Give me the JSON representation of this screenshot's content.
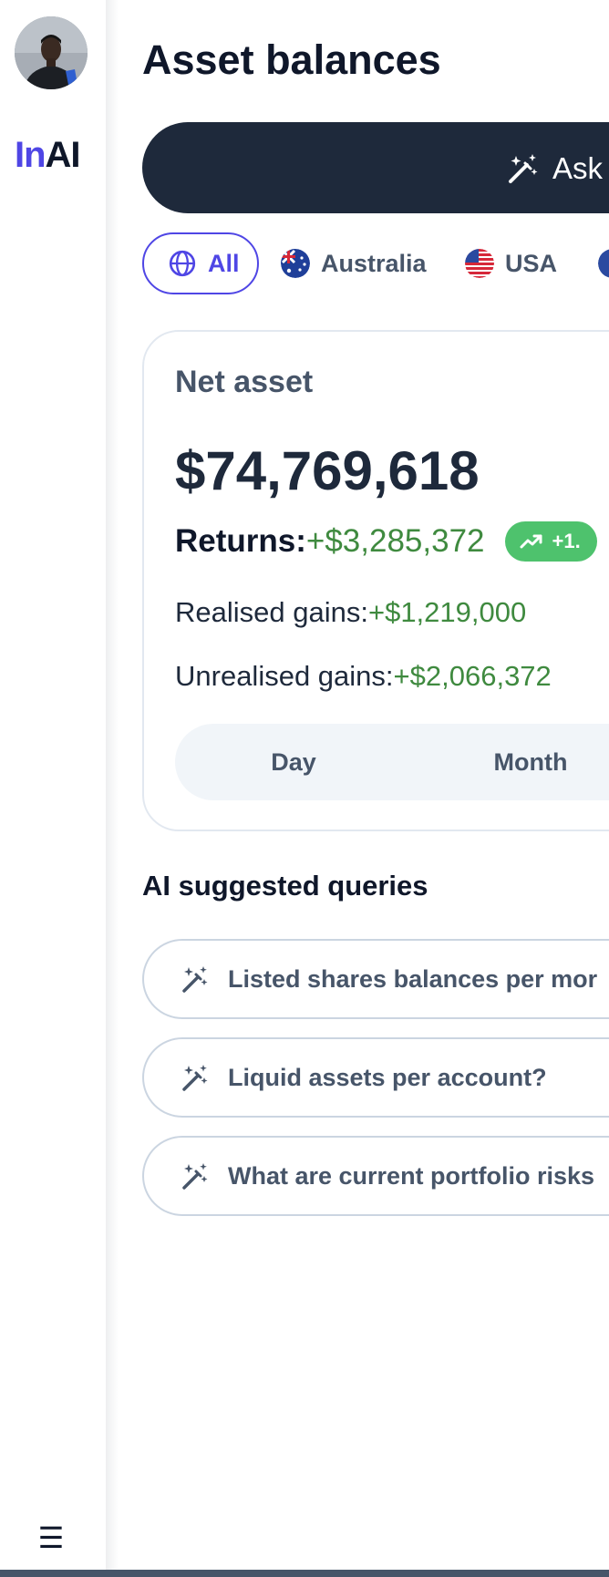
{
  "sidebar": {
    "avatar_icon": "user-avatar",
    "brand": {
      "part1": "In",
      "part2": "AI"
    },
    "brand_colors": {
      "accent": "#4f46e5",
      "dark": "#0f172a"
    },
    "menu_icon": "☰"
  },
  "page": {
    "title": "Asset balances"
  },
  "ask": {
    "icon": "magic-wand-icon",
    "label": "Ask"
  },
  "regions": [
    {
      "label": "All",
      "icon": "globe-icon",
      "selected": true
    },
    {
      "label": "Australia",
      "icon": "australia-flag-icon",
      "selected": false
    },
    {
      "label": "USA",
      "icon": "usa-flag-icon",
      "selected": false
    }
  ],
  "net_asset": {
    "title": "Net asset",
    "value": "$74,769,618",
    "returns_label": "Returns:",
    "returns_value": "+$3,285,372",
    "returns_badge": "+1.",
    "realised_label": "Realised gains:",
    "realised_value": "+$1,219,000",
    "unrealised_label": "Unrealised gains:",
    "unrealised_value": "+$2,066,372",
    "periods": [
      "Day",
      "Month"
    ],
    "positive_color": "#3f8a3f"
  },
  "suggestions": {
    "title": "AI suggested queries",
    "items": [
      "Listed shares balances per mor",
      "Liquid assets per account?",
      "What are current portfolio risks"
    ]
  }
}
